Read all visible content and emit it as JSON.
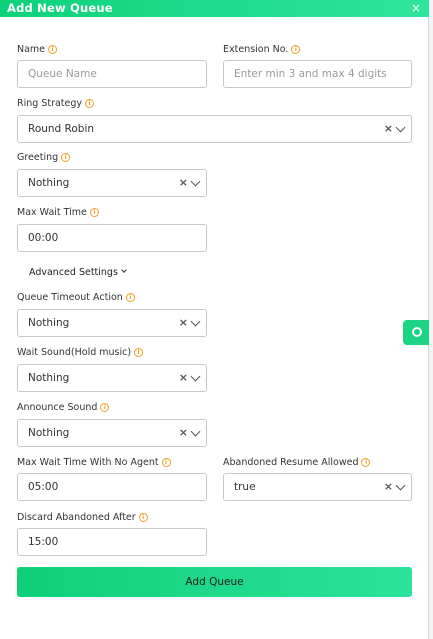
{
  "dialog": {
    "title": "Add New Queue",
    "close_icon": "×"
  },
  "fields": {
    "name": {
      "label": "Name",
      "placeholder": "Queue Name",
      "value": ""
    },
    "extension": {
      "label": "Extension No.",
      "placeholder": "Enter min 3 and max 4 digits",
      "value": ""
    },
    "ring_strategy": {
      "label": "Ring Strategy",
      "value": "Round Robin"
    },
    "greeting": {
      "label": "Greeting",
      "value": "Nothing"
    },
    "max_wait_time": {
      "label": "Max Wait Time",
      "value": "00:00"
    },
    "queue_timeout_action": {
      "label": "Queue Timeout Action",
      "value": "Nothing"
    },
    "wait_sound": {
      "label": "Wait Sound(Hold music)",
      "value": "Nothing"
    },
    "announce_sound": {
      "label": "Announce Sound",
      "value": "Nothing"
    },
    "max_wait_no_agent": {
      "label": "Max Wait Time With No Agent",
      "value": "05:00"
    },
    "abandoned_resume": {
      "label": "Abandoned Resume Allowed",
      "value": "true"
    },
    "discard_abandoned": {
      "label": "Discard Abandoned After",
      "value": "15:00"
    }
  },
  "advanced_settings": {
    "label": "Advanced Settings"
  },
  "submit": {
    "label": "Add Queue"
  },
  "icons": {
    "info": "i",
    "clear": "×"
  },
  "colors": {
    "accent": "#1bd583",
    "info": "#f0a020"
  }
}
